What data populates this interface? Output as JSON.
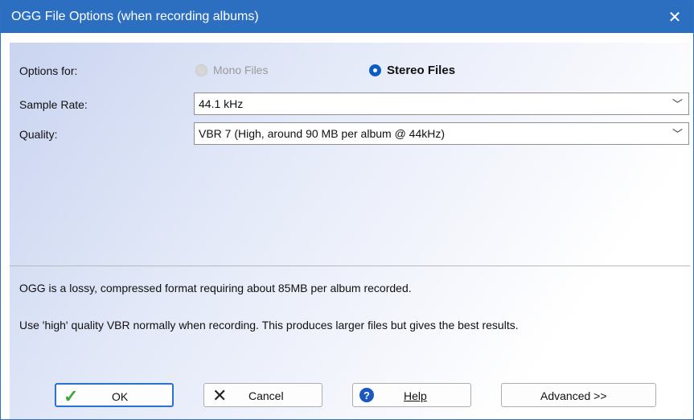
{
  "window": {
    "title": "OGG File Options (when recording albums)"
  },
  "form": {
    "options_for": {
      "label": "Options for:",
      "mono": "Mono Files",
      "stereo": "Stereo Files",
      "selected": "Stereo Files"
    },
    "sample_rate": {
      "label": "Sample Rate:",
      "value": "44.1 kHz"
    },
    "quality": {
      "label": "Quality:",
      "value": "VBR 7 (High, around 90 MB per album @ 44kHz)"
    }
  },
  "info": {
    "line1": "OGG is a lossy, compressed format requiring about 85MB per album recorded.",
    "line2": "Use 'high' quality VBR normally when recording.  This produces larger files but gives the best results."
  },
  "buttons": {
    "ok": "OK",
    "cancel": "Cancel",
    "help": "Help",
    "advanced": "Advanced >>"
  },
  "icons": {
    "close": "close-icon",
    "ok": "checkmark-icon",
    "cancel": "x-icon",
    "help": "help-icon"
  },
  "colors": {
    "titlebar": "#2c6fc1",
    "accent": "#0b5cc4"
  }
}
